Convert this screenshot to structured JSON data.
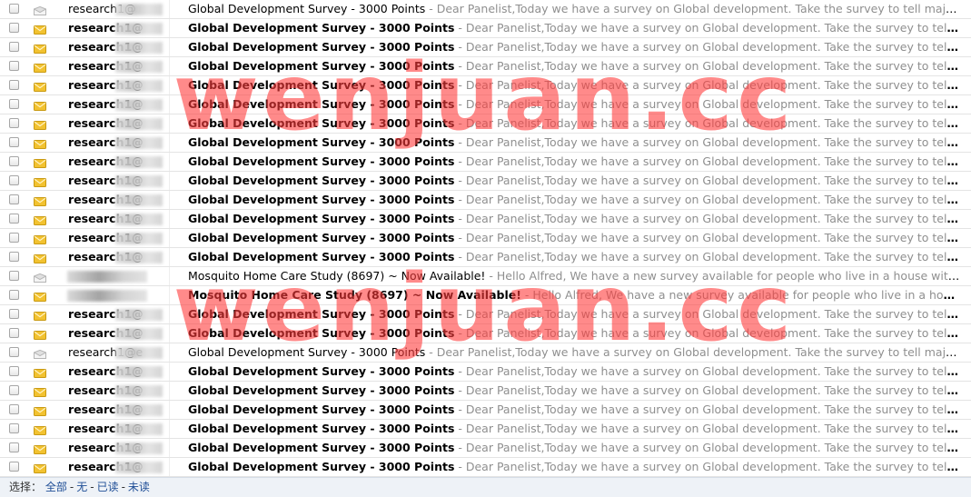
{
  "rows": [
    {
      "read": true,
      "sender": "research1@",
      "subject": "Global Development Survey - 3000 Points",
      "preview": " - Dear Panelist,Today we have a survey on Global development. Take the survey to tell major development issues"
    },
    {
      "read": false,
      "sender": "research1@",
      "subject": "Global Development Survey - 3000 Points",
      "preview": " - Dear Panelist,Today we have a survey on Global development. Take the survey to tell major development issues"
    },
    {
      "read": false,
      "sender": "research1@",
      "subject": "Global Development Survey - 3000 Points",
      "preview": " - Dear Panelist,Today we have a survey on Global development. Take the survey to tell major development issues"
    },
    {
      "read": false,
      "sender": "research1@",
      "subject": "Global Development Survey - 3000 Points",
      "preview": " - Dear Panelist,Today we have a survey on Global development. Take the survey to tell major development issues"
    },
    {
      "read": false,
      "sender": "research1@",
      "subject": "Global Development Survey - 3000 Points",
      "preview": " - Dear Panelist,Today we have a survey on Global development. Take the survey to tell major development issues"
    },
    {
      "read": false,
      "sender": "research1@",
      "subject": "Global Development Survey - 3000 Points",
      "preview": " - Dear Panelist,Today we have a survey on Global development. Take the survey to tell major development issues"
    },
    {
      "read": false,
      "sender": "research1@",
      "subject": "Global Development Survey - 3000 Points",
      "preview": " - Dear Panelist,Today we have a survey on Global development. Take the survey to tell major development issues"
    },
    {
      "read": false,
      "sender": "research1@",
      "subject": "Global Development Survey - 3000 Points",
      "preview": " - Dear Panelist,Today we have a survey on Global development. Take the survey to tell major development issues"
    },
    {
      "read": false,
      "sender": "research1@",
      "subject": "Global Development Survey - 3000 Points",
      "preview": " - Dear Panelist,Today we have a survey on Global development. Take the survey to tell major development issues"
    },
    {
      "read": false,
      "sender": "research1@",
      "subject": "Global Development Survey - 3000 Points",
      "preview": " - Dear Panelist,Today we have a survey on Global development. Take the survey to tell major development issues"
    },
    {
      "read": false,
      "sender": "research1@",
      "subject": "Global Development Survey - 3000 Points",
      "preview": " - Dear Panelist,Today we have a survey on Global development. Take the survey to tell major development issues"
    },
    {
      "read": false,
      "sender": "research1@",
      "subject": "Global Development Survey - 3000 Points",
      "preview": " - Dear Panelist,Today we have a survey on Global development. Take the survey to tell major development issues"
    },
    {
      "read": false,
      "sender": "research1@",
      "subject": "Global Development Survey - 3000 Points",
      "preview": " - Dear Panelist,Today we have a survey on Global development. Take the survey to tell major development issues"
    },
    {
      "read": false,
      "sender": "research1@",
      "subject": "Global Development Survey - 3000 Points",
      "preview": " - Dear Panelist,Today we have a survey on Global development. Take the survey to tell major development issues"
    },
    {
      "read": true,
      "sender": "",
      "subject": "Mosquito Home Care Study (8697) ~ Now Available!",
      "preview": " - Hello Alfred, We have a new survey available for people who live in a house with a lawn"
    },
    {
      "read": false,
      "sender": "",
      "subject": "Mosquito Home Care Study (8697) ~ Now Available!",
      "preview": " - Hello Alfred, We have a new survey available for people who live in a house with a lawn"
    },
    {
      "read": false,
      "sender": "research1@",
      "subject": "Global Development Survey - 3000 Points",
      "preview": " - Dear Panelist,Today we have a survey on Global development. Take the survey to tell major development issues"
    },
    {
      "read": false,
      "sender": "research1@",
      "subject": "Global Development Survey - 3000 Points",
      "preview": " - Dear Panelist,Today we have a survey on Global development. Take the survey to tell major development issues"
    },
    {
      "read": true,
      "sender": "research1@e",
      "subject": "Global Development Survey - 3000 Points",
      "preview": " - Dear Panelist,Today we have a survey on Global development. Take the survey to tell major development issues"
    },
    {
      "read": false,
      "sender": "research1@",
      "subject": "Global Development Survey - 3000 Points",
      "preview": " - Dear Panelist,Today we have a survey on Global development. Take the survey to tell major development issues"
    },
    {
      "read": false,
      "sender": "research1@",
      "subject": "Global Development Survey - 3000 Points",
      "preview": " - Dear Panelist,Today we have a survey on Global development. Take the survey to tell major development issues"
    },
    {
      "read": false,
      "sender": "research1@",
      "subject": "Global Development Survey - 3000 Points",
      "preview": " - Dear Panelist,Today we have a survey on Global development. Take the survey to tell major development issues"
    },
    {
      "read": false,
      "sender": "research1@",
      "subject": "Global Development Survey - 3000 Points",
      "preview": " - Dear Panelist,Today we have a survey on Global development. Take the survey to tell major development issues"
    },
    {
      "read": false,
      "sender": "research1@",
      "subject": "Global Development Survey - 3000 Points",
      "preview": " - Dear Panelist,Today we have a survey on Global development. Take the survey to tell major development issues"
    },
    {
      "read": false,
      "sender": "research1@",
      "subject": "Global Development Survey - 3000 Points",
      "preview": " - Dear Panelist,Today we have a survey on Global development. Take the survey to tell major development issues"
    }
  ],
  "select_bar": {
    "label": "选择：",
    "all": "全部",
    "none": "无",
    "read": "已读",
    "unread": "未读",
    "dash": "-"
  },
  "watermark": "wenjuan.cc",
  "colors": {
    "unread_envelope": "#f2c230",
    "read_envelope": "#c9c9c9",
    "preview_text": "#8f8f8f",
    "link": "#1f4e96",
    "watermark": "#ff3c3c"
  }
}
